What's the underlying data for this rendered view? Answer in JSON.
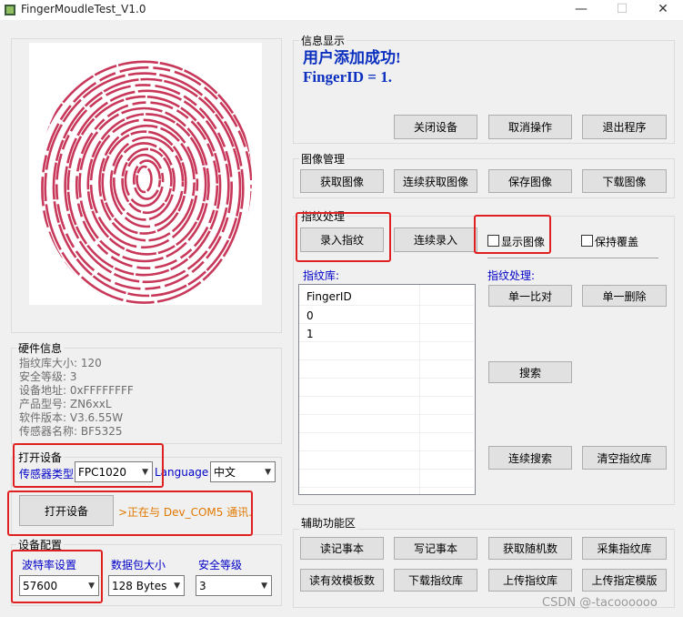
{
  "window": {
    "title": "FingerMoudleTest_V1.0",
    "minimize": "—",
    "maximize": "☐",
    "close": "✕"
  },
  "info": {
    "title": "信息显示",
    "line1": "用户添加成功!",
    "line2": "FingerID = 1.",
    "btn_close_device": "关闭设备",
    "btn_cancel": "取消操作",
    "btn_exit": "退出程序"
  },
  "image_mgmt": {
    "title": "图像管理",
    "btn_get": "获取图像",
    "btn_continuous": "连续获取图像",
    "btn_save": "保存图像",
    "btn_download": "下载图像"
  },
  "finger_proc": {
    "title": "指纹处理",
    "btn_enroll": "录入指纹",
    "btn_continuous_enroll": "连续录入",
    "chk_show_image": "显示图像",
    "chk_keep_cover": "保持覆盖",
    "lib_label": "指纹库:",
    "proc_label": "指纹处理:",
    "btn_match_one": "单一比对",
    "btn_delete_one": "单一删除",
    "btn_search": "搜索",
    "btn_continuous_search": "连续搜索",
    "btn_clear_lib": "清空指纹库"
  },
  "finger_lib": {
    "header": "FingerID",
    "rows": [
      "0",
      "1"
    ]
  },
  "hardware": {
    "title": "硬件信息",
    "lines": [
      "指纹库大小: 120",
      "安全等级: 3",
      "设备地址: 0xFFFFFFFF",
      "产品型号: ZN6xxL",
      "软件版本: V3.6.55W",
      "传感器名称: BF5325"
    ]
  },
  "open_device": {
    "title": "打开设备",
    "sensor_type_label": "传感器类型",
    "sensor_type_value": "FPC1020",
    "language_label": "Language",
    "language_value": "中文",
    "btn_open": "打开设备",
    "status": ">正在与 Dev_COM5 通讯."
  },
  "config": {
    "title": "设备配置",
    "baud_label": "波特率设置",
    "baud_value": "57600",
    "packet_label": "数据包大小",
    "packet_value": "128 Bytes",
    "security_label": "安全等级",
    "security_value": "3"
  },
  "aux": {
    "title": "辅助功能区",
    "btn_read_notepad": "读记事本",
    "btn_write_notepad": "写记事本",
    "btn_random": "获取随机数",
    "btn_collect_lib": "采集指纹库",
    "btn_read_valid": "读有效模板数",
    "btn_download_lib": "下载指纹库",
    "btn_upload_lib": "上传指纹库",
    "btn_upload_template": "上传指定模版"
  },
  "watermark": "CSDN @-tacoooooo",
  "colors": {
    "fingerprint": "#c8385a",
    "info_text": "#0b2fbf",
    "highlight": "#e02020",
    "status": "#e07800",
    "link_blue": "#0000c8"
  }
}
